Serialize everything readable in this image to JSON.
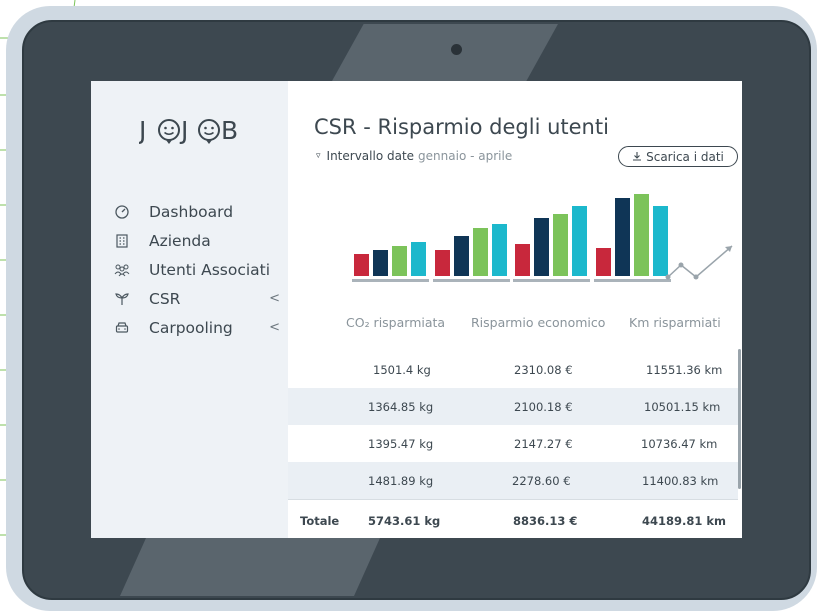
{
  "app": {
    "logo_text": "J☺J☺B",
    "page_title": "CSR - Risparmio degli utenti"
  },
  "sidebar": {
    "items": [
      {
        "label": "Dashboard",
        "icon": "speedometer-icon",
        "has_submenu": false
      },
      {
        "label": "Azienda",
        "icon": "building-icon",
        "has_submenu": false
      },
      {
        "label": "Utenti Associati",
        "icon": "users-icon",
        "has_submenu": false
      },
      {
        "label": "CSR",
        "icon": "plant-icon",
        "has_submenu": true
      },
      {
        "label": "Carpooling",
        "icon": "car-icon",
        "has_submenu": true
      }
    ],
    "chevron": "<"
  },
  "filter": {
    "label": "Intervallo date",
    "range": "gennaio - aprile"
  },
  "download": {
    "label": "Scarica i dati",
    "icon": "download-icon"
  },
  "columns": [
    "CO₂ risparmiata",
    "Risparmio economico",
    "Km risparmiati"
  ],
  "table": {
    "rows": [
      {
        "co2": "1501.4  kg",
        "eco": "2310.08 €",
        "km": "11551.36 km"
      },
      {
        "co2": "1364.85 kg",
        "eco": "2100.18 €",
        "km": "10501.15 km"
      },
      {
        "co2": "1395.47 kg",
        "eco": "2147.27 €",
        "km": "10736.47 km"
      },
      {
        "co2": "1481.89 kg",
        "eco": "2278.60 €",
        "km": "11400.83 km"
      }
    ],
    "total": {
      "label": "Totale",
      "co2": "5743.61 kg",
      "eco": "8836.13 €",
      "km": "44189.81 km"
    }
  },
  "colors": {
    "red": "#c8283c",
    "navy": "#0f3556",
    "green": "#7cc35a",
    "cyan": "#1cb8cc",
    "text": "#3d4850"
  },
  "chart_data": {
    "type": "bar",
    "categories": [
      "1",
      "2",
      "3",
      "4"
    ],
    "series": [
      {
        "values": [
          22,
          26,
          32,
          28
        ]
      },
      {
        "values": [
          26,
          40,
          58,
          78
        ]
      },
      {
        "values": [
          30,
          48,
          62,
          82
        ]
      },
      {
        "values": [
          34,
          52,
          70,
          70
        ]
      }
    ]
  }
}
